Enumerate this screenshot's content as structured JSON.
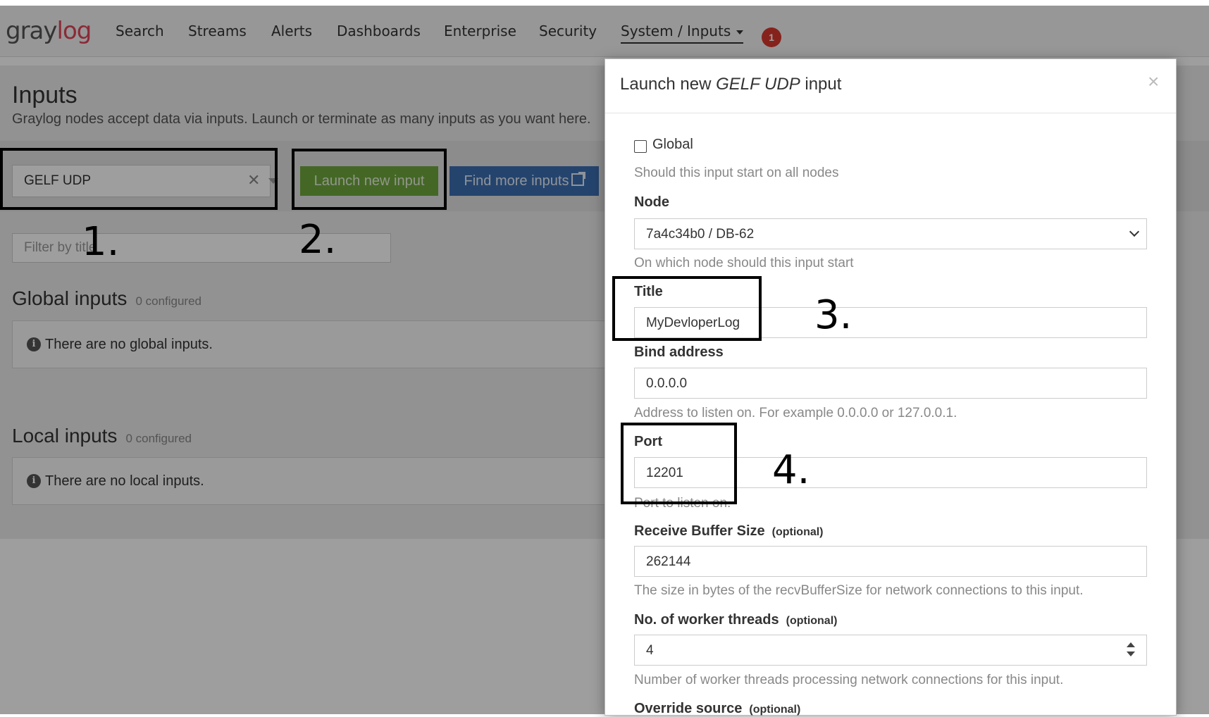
{
  "navbar": {
    "logo_main": "gray",
    "logo_accent": "log",
    "items": [
      "Search",
      "Streams",
      "Alerts",
      "Dashboards",
      "Enterprise",
      "Security",
      "System / Inputs"
    ],
    "notification_count": "1"
  },
  "page": {
    "title": "Inputs",
    "description": "Graylog nodes accept data via inputs. Launch or terminate as many inputs as you want here.",
    "input_type_select": "GELF UDP",
    "launch_button": "Launch new input",
    "find_more_button": "Find more inputs",
    "filter_placeholder": "Filter by title",
    "global_inputs": {
      "title": "Global inputs",
      "count": "0 configured",
      "empty": "There are no global inputs."
    },
    "local_inputs": {
      "title": "Local inputs",
      "count": "0 configured",
      "empty": "There are no local inputs."
    }
  },
  "modal": {
    "title_prefix": "Launch new ",
    "title_type": "GELF UDP",
    "title_suffix": " input",
    "close": "×",
    "global_label": "Global",
    "global_help": "Should this input start on all nodes",
    "node_label": "Node",
    "node_value": "7a4c34b0 / DB-62",
    "node_help": "On which node should this input start",
    "title_label": "Title",
    "title_value": "MyDevloperLog",
    "bind_label": "Bind address",
    "bind_value": "0.0.0.0",
    "bind_help": "Address to listen on. For example 0.0.0.0 or 127.0.0.1.",
    "port_label": "Port",
    "port_value": "12201",
    "port_help": "Port to listen on.",
    "buffer_label": "Receive Buffer Size",
    "buffer_optional": "(optional)",
    "buffer_value": "262144",
    "buffer_help": "The size in bytes of the recvBufferSize for network connections to this input.",
    "workers_label": "No. of worker threads",
    "workers_optional": "(optional)",
    "workers_value": "4",
    "workers_help": "Number of worker threads processing network connections for this input.",
    "override_label": "Override source",
    "override_optional": "(optional)"
  },
  "annotations": [
    "1.",
    "2.",
    "3.",
    "4."
  ],
  "colors": {
    "launch_button": "#6fa63e",
    "find_button": "#3d6fb0",
    "badge": "#d9382e",
    "logo_accent": "#e0445a"
  }
}
